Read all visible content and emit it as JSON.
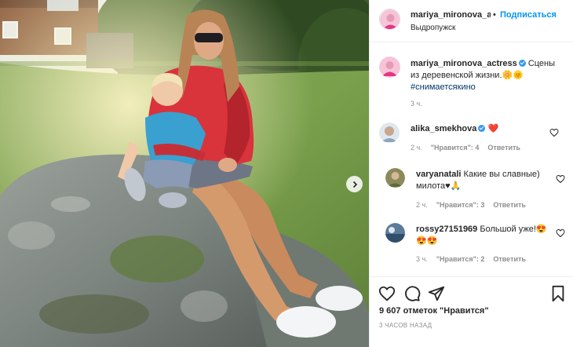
{
  "post": {
    "author": "mariya_mironova_actress",
    "author_header": "mariya_mironova_a",
    "separator": "•",
    "follow_label": "Подписаться",
    "location": "Выдропужск",
    "caption": {
      "username": "mariya_mironova_actress",
      "text": "Сцены из деревенской жизни.",
      "emoji": "🌼🌞",
      "hashtag": "#снимаетсякино",
      "time": "3 ч."
    },
    "likes": "9 607 отметок \"Нравится\"",
    "posted": "3 ЧАСОВ НАЗАД"
  },
  "comments": [
    {
      "username": "alika_smekhova",
      "verified": true,
      "text": "",
      "emoji": "❤️",
      "time": "2 ч.",
      "likes": "\"Нравится\": 4",
      "reply": "Ответить"
    },
    {
      "username": "varyanatali",
      "verified": false,
      "text": "Какие вы славные) милота♥",
      "emoji": "🙏",
      "time": "2 ч.",
      "likes": "\"Нравится\": 3",
      "reply": "Ответить"
    },
    {
      "username": "rossy27151969",
      "verified": false,
      "text": "Большой уже!",
      "emoji": "😍",
      "emoji2": "😍😍",
      "time": "3 ч.",
      "likes": "\"Нравится\": 2",
      "reply": "Ответить"
    }
  ],
  "colors": {
    "link_blue": "#0095f6",
    "verified_blue": "#3897f0",
    "hashtag": "#00376b",
    "heart_red": "#ed4956",
    "muted": "#8e8e8e"
  },
  "icons": [
    "next-arrow-icon",
    "heart-icon",
    "comment-icon",
    "share-icon",
    "bookmark-icon",
    "verified-icon"
  ]
}
